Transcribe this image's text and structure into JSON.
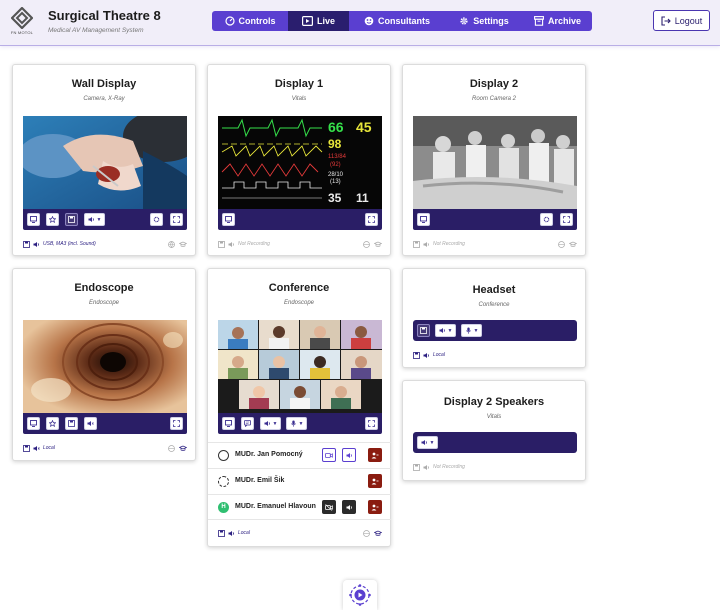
{
  "app": {
    "title": "Surgical Theatre 8",
    "subtitle": "Medical AV Management System",
    "logo_text": "FN MOTOL"
  },
  "nav": {
    "items": [
      {
        "label": "Controls",
        "icon": "gauge-icon",
        "active": false
      },
      {
        "label": "Live",
        "icon": "play-screen-icon",
        "active": true
      },
      {
        "label": "Consultants",
        "icon": "consultants-icon",
        "active": false
      },
      {
        "label": "Settings",
        "icon": "gear-icon",
        "active": false
      },
      {
        "label": "Archive",
        "icon": "archive-icon",
        "active": false
      }
    ],
    "logout_label": "Logout"
  },
  "colors": {
    "accent": "#5a3fd0",
    "nav_active": "#2a1e6e",
    "control_bar": "#2a1e66",
    "danger": "#8a1c10",
    "online": "#2fbf71"
  },
  "cards": {
    "wall_display": {
      "title": "Wall Display",
      "subtitle": "Camera, X-Ray",
      "status": "USB, MA3 (incl. Sound)"
    },
    "display1": {
      "title": "Display 1",
      "subtitle": "Vitals",
      "status": "Not Recording",
      "vitals": [
        "66",
        "45",
        "98",
        "113/84",
        "(92)",
        "28/10",
        "(13)",
        "35",
        "11"
      ]
    },
    "display2": {
      "title": "Display 2",
      "subtitle": "Room Camera 2",
      "status": "Not Recording"
    },
    "endoscope": {
      "title": "Endoscope",
      "subtitle": "Endoscope",
      "status": "Local"
    },
    "conference": {
      "title": "Conference",
      "subtitle": "Endoscope",
      "status": "Local",
      "participants": [
        {
          "name": "MUDr. Jan Pomocný",
          "avatar": "H"
        },
        {
          "name": "MUDr. Emil Šik",
          "avatar": ""
        },
        {
          "name": "MUDr. Emanuel Hlavoun",
          "avatar": "H"
        }
      ]
    },
    "headset": {
      "title": "Headset",
      "subtitle": "Conference",
      "status": "Local"
    },
    "display2_speakers": {
      "title": "Display 2 Speakers",
      "subtitle": "Vitals",
      "status": "Not Recording"
    }
  }
}
